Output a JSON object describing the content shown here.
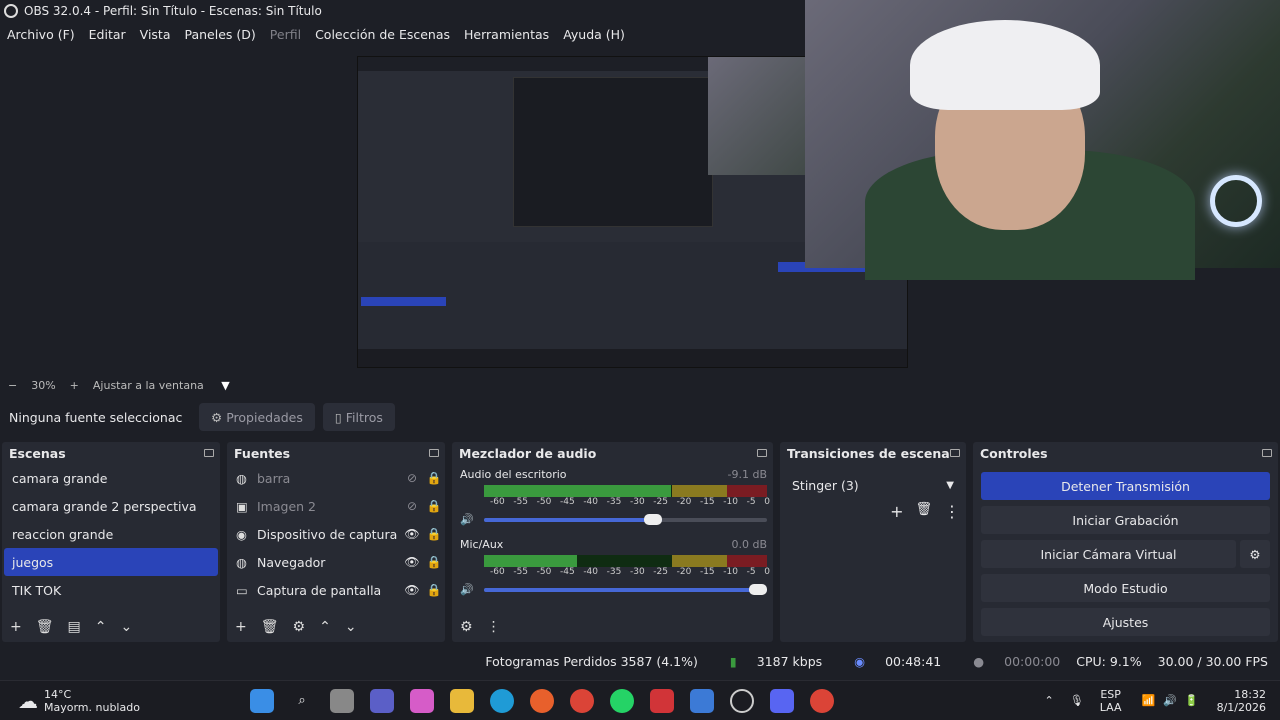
{
  "window": {
    "title": "OBS 32.0.4 - Perfil: Sin Título - Escenas: Sin Título"
  },
  "menu": [
    {
      "label": "Archivo (F)",
      "dim": false
    },
    {
      "label": "Editar",
      "dim": false
    },
    {
      "label": "Vista",
      "dim": false
    },
    {
      "label": "Paneles (D)",
      "dim": false
    },
    {
      "label": "Perfil",
      "dim": true
    },
    {
      "label": "Colección de Escenas",
      "dim": false
    },
    {
      "label": "Herramientas",
      "dim": false
    },
    {
      "label": "Ayuda (H)",
      "dim": false
    }
  ],
  "zoom": {
    "minus": "−",
    "level": "30%",
    "plus": "+",
    "fit": "Ajustar a la ventana"
  },
  "source_bar": {
    "none_selected": "Ninguna fuente seleccionac",
    "properties": "Propiedades",
    "filters": "Filtros"
  },
  "scenes": {
    "title": "Escenas",
    "items": [
      "camara grande",
      "camara grande 2 perspectiva",
      "reaccion grande",
      "juegos",
      "TIK TOK"
    ],
    "selected_index": 3
  },
  "sources": {
    "title": "Fuentes",
    "items": [
      {
        "name": "barra",
        "icon": "globe-icon",
        "visible": false
      },
      {
        "name": "Imagen 2",
        "icon": "image-icon",
        "visible": false
      },
      {
        "name": "Dispositivo de captura d",
        "icon": "camera-icon",
        "visible": true
      },
      {
        "name": "Navegador",
        "icon": "globe-icon",
        "visible": true
      },
      {
        "name": "Captura de pantalla",
        "icon": "monitor-icon",
        "visible": true
      }
    ]
  },
  "mixer": {
    "title": "Mezclador de audio",
    "channels": [
      {
        "name": "Audio del escritorio",
        "db": "-9.1 dB",
        "level": 0.86,
        "volume": 0.63
      },
      {
        "name": "Mic/Aux",
        "db": "0.0 dB",
        "level": 0.33,
        "volume": 1.0
      }
    ],
    "scale": [
      "-60",
      "-55",
      "-50",
      "-45",
      "-40",
      "-35",
      "-30",
      "-25",
      "-20",
      "-15",
      "-10",
      "-5",
      "0"
    ]
  },
  "transitions": {
    "title": "Transiciones de escena",
    "selected": "Stinger (3)"
  },
  "controls": {
    "title": "Controles",
    "stop_stream": "Detener Transmisión",
    "start_recording": "Iniciar Grabación",
    "virtual_camera": "Iniciar Cámara Virtual",
    "studio_mode": "Modo Estudio",
    "settings": "Ajustes"
  },
  "status": {
    "dropped": "Fotogramas Perdidos 3587 (4.1%)",
    "bitrate": "3187 kbps",
    "stream_time": "00:48:41",
    "rec_time": "00:00:00",
    "cpu": "CPU: 9.1%",
    "fps": "30.00 / 30.00 FPS"
  },
  "taskbar": {
    "temp": "14°C",
    "weather": "Mayorm. nublado",
    "lang1": "ESP",
    "lang2": "LAA",
    "time": "18:32",
    "date": "8/1/2026"
  },
  "colors": {
    "accent": "#2a44b8",
    "dock": "#272a33",
    "bg": "#1d1f26"
  }
}
